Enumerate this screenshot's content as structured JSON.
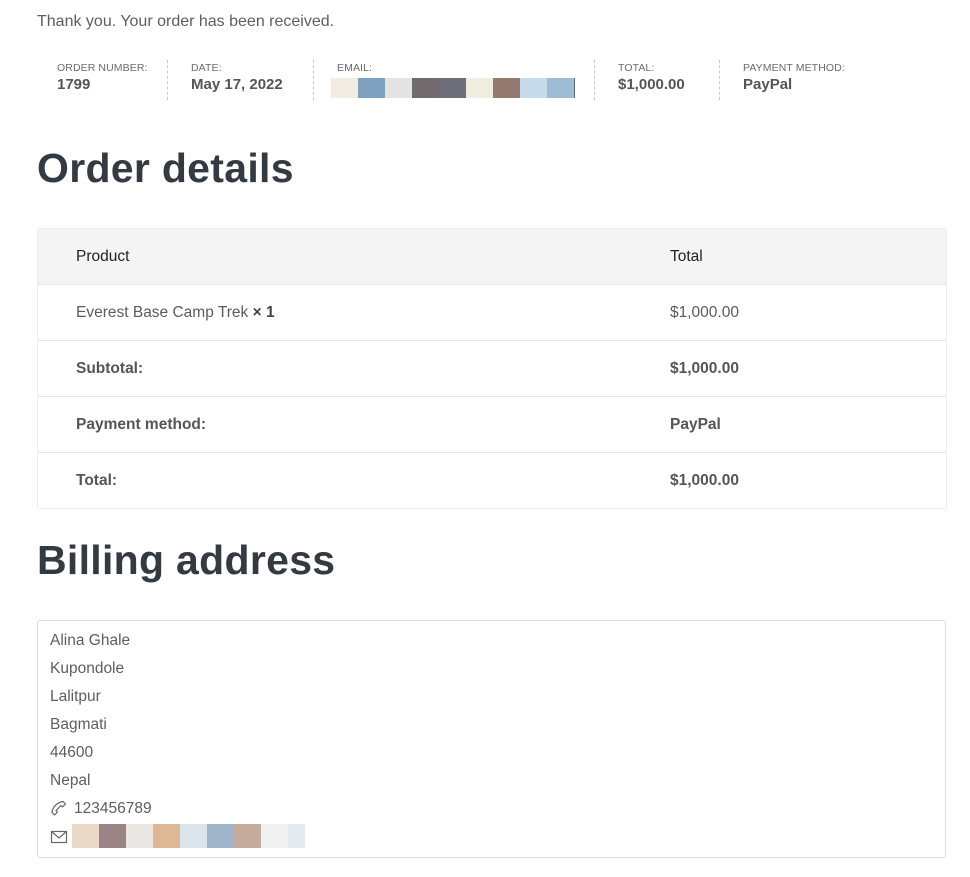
{
  "thank_you": "Thank you. Your order has been received.",
  "overview": {
    "order_number": {
      "label": "ORDER NUMBER:",
      "value": "1799"
    },
    "date": {
      "label": "DATE:",
      "value": "May 17, 2022"
    },
    "email": {
      "label": "EMAIL:"
    },
    "total": {
      "label": "TOTAL:",
      "value": "$1,000.00"
    },
    "payment_method": {
      "label": "PAYMENT METHOD:",
      "value": "PayPal"
    }
  },
  "order_details": {
    "heading": "Order details",
    "columns": {
      "product": "Product",
      "total": "Total"
    },
    "item": {
      "name": "Everest Base Camp Trek",
      "qty": "× 1",
      "total": "$1,000.00"
    },
    "subtotal": {
      "label": "Subtotal:",
      "value": "$1,000.00"
    },
    "payment": {
      "label": "Payment method:",
      "value": "PayPal"
    },
    "grand_total": {
      "label": "Total:",
      "value": "$1,000.00"
    }
  },
  "billing": {
    "heading": "Billing address",
    "name": "Alina Ghale",
    "street": "Kupondole",
    "city": "Lalitpur",
    "state": "Bagmati",
    "postcode": "44600",
    "country": "Nepal",
    "phone": "123456789",
    "phone_icon": "phone-icon",
    "email_icon": "mail-icon"
  },
  "colors": {
    "heading": "#333a42",
    "text": "#5b5b5b",
    "table_head_bg": "#f4f4f4",
    "border": "#e6e6e6"
  }
}
